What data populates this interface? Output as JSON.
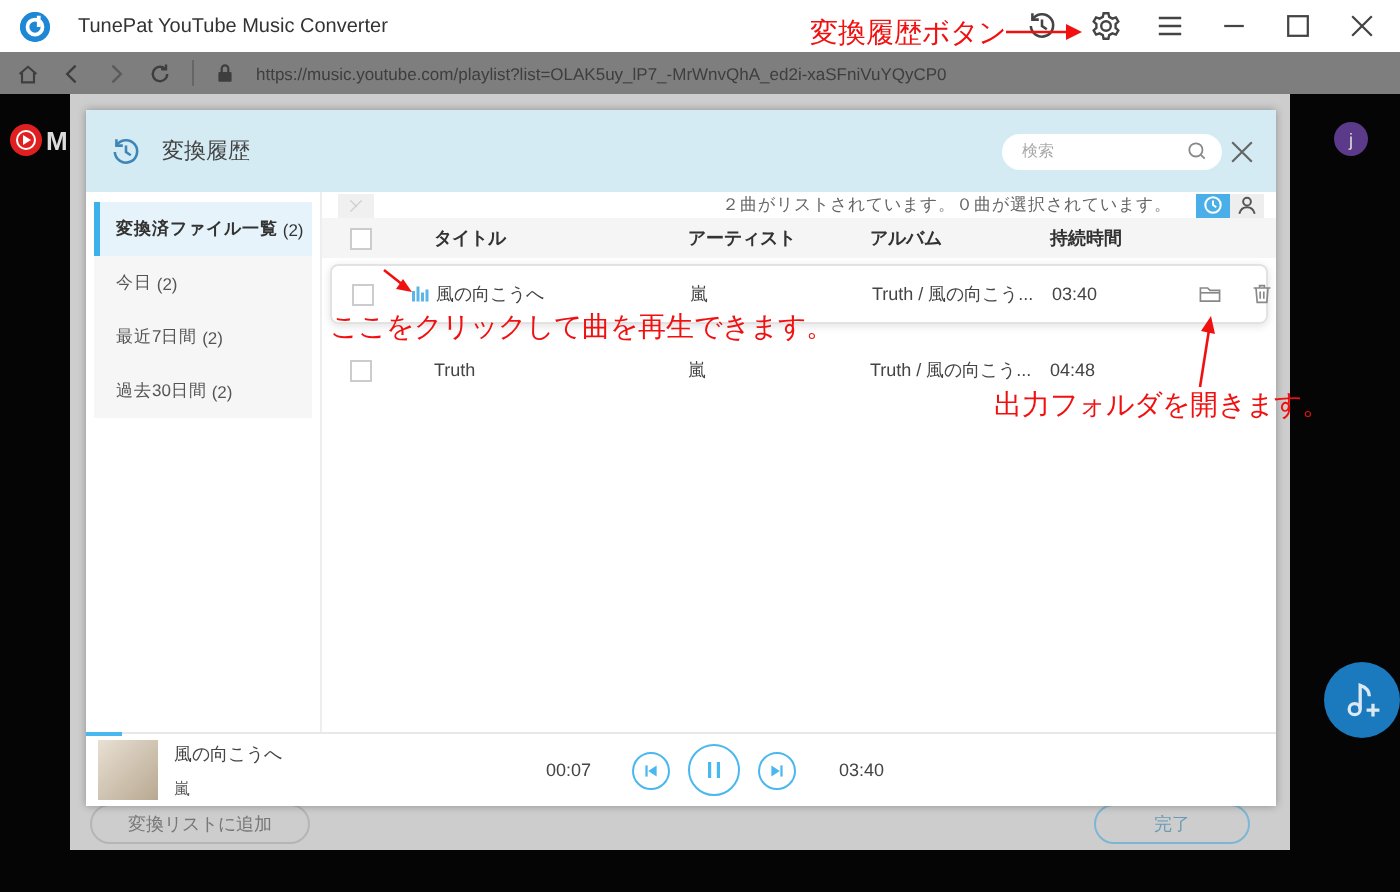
{
  "title_bar": {
    "title": "TunePat YouTube Music Converter"
  },
  "address_bar": {
    "url": "https://music.youtube.com/playlist?list=OLAK5uy_lP7_-MrWnvQhA_ed2i-xaSFniVuYQyCP0"
  },
  "background_page": {
    "logo_text": "M",
    "avatar_letter": "j",
    "buttons": [
      {
        "label": "変換リストに追加",
        "kind": "secondary"
      },
      {
        "label": "完了",
        "kind": "primary"
      }
    ]
  },
  "dialog": {
    "title": "変換履歴",
    "search": {
      "placeholder": "検索"
    },
    "sidebar": [
      {
        "label": "変換済ファイル一覧",
        "count": "(2)",
        "selected": true
      },
      {
        "label": "今日",
        "count": "(2)",
        "selected": false
      },
      {
        "label": "最近7日間",
        "count": "(2)",
        "selected": false
      },
      {
        "label": "過去30日間",
        "count": "(2)",
        "selected": false
      }
    ],
    "status": "２曲がリストされています。０曲が選択されています。",
    "view_toggle": [
      {
        "kind": "time",
        "selected": true
      },
      {
        "kind": "artist",
        "selected": false
      }
    ],
    "columns": [
      "タイトル",
      "アーティスト",
      "アルバム",
      "持続時間"
    ],
    "select_all_checked": false,
    "rows": [
      {
        "title": "風の向こうへ",
        "artist": "嵐",
        "album": "Truth / 風の向こう...",
        "duration": "03:40",
        "checked": false,
        "playing": true,
        "hovered": true
      },
      {
        "title": "Truth",
        "artist": "嵐",
        "album": "Truth / 風の向こう...",
        "duration": "04:48",
        "checked": false,
        "playing": false,
        "hovered": false
      }
    ],
    "player": {
      "title": "風の向こうへ",
      "artist": "嵐",
      "elapsed": "00:07",
      "total": "03:40",
      "level": 0.03
    }
  },
  "annotations": [
    {
      "kind": "history",
      "text": "変換履歴ボタン"
    },
    {
      "kind": "play",
      "text": "ここをクリックして曲を再生できます。"
    },
    {
      "kind": "folder",
      "text": "出力フォルダを開きます。"
    }
  ]
}
